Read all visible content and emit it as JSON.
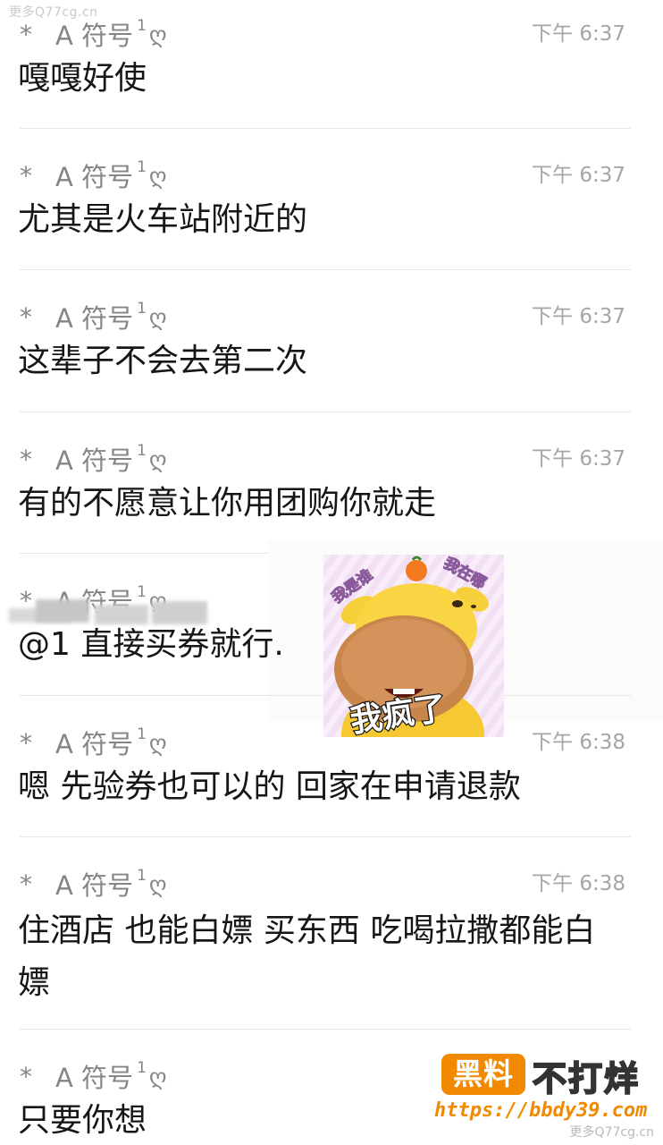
{
  "watermark": {
    "top": "更多Q77cg.cn",
    "bottom": "更多Q77cg.cn"
  },
  "messages": [
    {
      "star": "*",
      "name": "A 符号",
      "sup": "1",
      "glyph": "ღ",
      "time": "下午 6:37",
      "text": "嘎嘎好使"
    },
    {
      "star": "*",
      "name": "A 符号",
      "sup": "1",
      "glyph": "ღ",
      "time": "下午 6:37",
      "text": "尤其是火车站附近的"
    },
    {
      "star": "*",
      "name": "A 符号",
      "sup": "1",
      "glyph": "ღ",
      "time": "下午 6:37",
      "text": "这辈子不会去第二次"
    },
    {
      "star": "*",
      "name": "A 符号",
      "sup": "1",
      "glyph": "ღ",
      "time": "下午 6:37",
      "text": "有的不愿意让你用团购你就走"
    },
    {
      "star": "*",
      "name": "A 符号",
      "sup": "1",
      "glyph": "ღ",
      "time": "",
      "text": "@1 直接买券就行."
    },
    {
      "star": "*",
      "name": "A 符号",
      "sup": "1",
      "glyph": "ღ",
      "time": "下午 6:38",
      "text": "嗯 先验券也可以的 回家在申请退款"
    },
    {
      "star": "*",
      "name": "A 符号",
      "sup": "1",
      "glyph": "ღ",
      "time": "下午 6:38",
      "text": "住酒店 也能白嫖 买东西 吃喝拉撒都能白嫖"
    },
    {
      "star": "*",
      "name": "A 符号",
      "sup": "1",
      "glyph": "ღ",
      "time": "",
      "text": "只要你想"
    }
  ],
  "sticker": {
    "top_left": "我是谁",
    "top_right": "我在哪",
    "caption": "我疯了"
  },
  "logo": {
    "box": "黑料",
    "text": "不打烊",
    "url": "https://bbdy39.com"
  },
  "colors": {
    "accent": "#f18a00",
    "divider": "#e6e6e6",
    "time": "#a6a6a6",
    "header": "#858585"
  }
}
